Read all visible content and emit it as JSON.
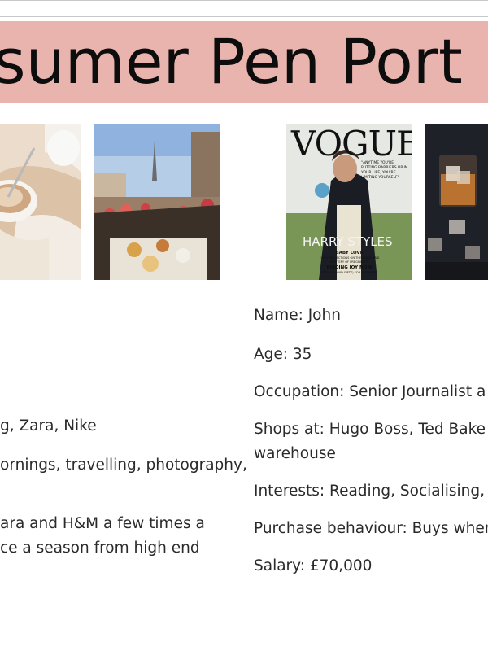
{
  "title": "sumer Pen Port",
  "images": {
    "vogue": {
      "masthead": "VOGUE",
      "cover_name": "HARRY STYLES",
      "quote": "\"ANYTIME YOU'RE PUTTING BARRIERS UP IN YOUR LIFE, YOU'RE LIMITING YOURSELF\"",
      "coverline1": "BABY LOVE",
      "coverline1_sub": "EARLY REFLECTIONS ON THE MAGIC AND MYSTERY OF PREGNANCY",
      "coverline2": "FINDING JOY NOW",
      "coverline2_sub": "FASHION (AND GIFTS) FOR EVERYONE"
    }
  },
  "left_column": {
    "shops": "g, Zara, Nike",
    "interests_1": "ornings, travelling, photography,",
    "purchase_1": "ara and H&M a few times a",
    "purchase_2": "ce a season from high end"
  },
  "right_column": {
    "name": "Name: John",
    "age": "Age: 35",
    "occupation": "Occupation: Senior Journalist a",
    "shops_1": "Shops at: Hugo Boss, Ted Bake",
    "shops_2": "warehouse",
    "interests": "Interests: Reading, Socialising, ",
    "purchase": "Purchase behaviour: Buys when",
    "salary": "Salary: £70,000"
  }
}
